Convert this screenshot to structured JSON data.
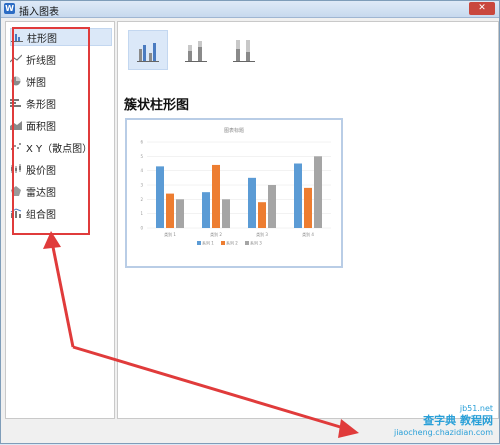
{
  "window": {
    "title": "插入图表",
    "app_icon": "W",
    "close": "✕"
  },
  "sidebar": {
    "items": [
      {
        "label": "柱形图",
        "icon": "bar-chart-icon"
      },
      {
        "label": "折线图",
        "icon": "line-chart-icon"
      },
      {
        "label": "饼图",
        "icon": "pie-chart-icon"
      },
      {
        "label": "条形图",
        "icon": "horizontal-bar-chart-icon"
      },
      {
        "label": "面积图",
        "icon": "area-chart-icon"
      },
      {
        "label": "X Y（散点图）",
        "icon": "scatter-chart-icon"
      },
      {
        "label": "股价图",
        "icon": "stock-chart-icon"
      },
      {
        "label": "雷达图",
        "icon": "radar-chart-icon"
      },
      {
        "label": "组合图",
        "icon": "combo-chart-icon"
      }
    ]
  },
  "main": {
    "heading": "簇状柱形图"
  },
  "chart_data": {
    "type": "bar",
    "title": "图表标题",
    "categories": [
      "类别 1",
      "类别 2",
      "类别 3",
      "类别 4"
    ],
    "series": [
      {
        "name": "系列 1",
        "values": [
          4.3,
          2.5,
          3.5,
          4.5
        ],
        "color": "#5b9bd5"
      },
      {
        "name": "系列 2",
        "values": [
          2.4,
          4.4,
          1.8,
          2.8
        ],
        "color": "#ed7d31"
      },
      {
        "name": "系列 3",
        "values": [
          2.0,
          2.0,
          3.0,
          5.0
        ],
        "color": "#a5a5a5"
      }
    ],
    "ylim": [
      0,
      6
    ],
    "y_ticks": [
      0,
      1,
      2,
      3,
      4,
      5,
      6
    ],
    "grid": true,
    "legend": "bottom"
  },
  "watermark": {
    "line1": "查字典 教程网",
    "line2": "jiaocheng.chazidian.com",
    "site": "jb51.net"
  }
}
